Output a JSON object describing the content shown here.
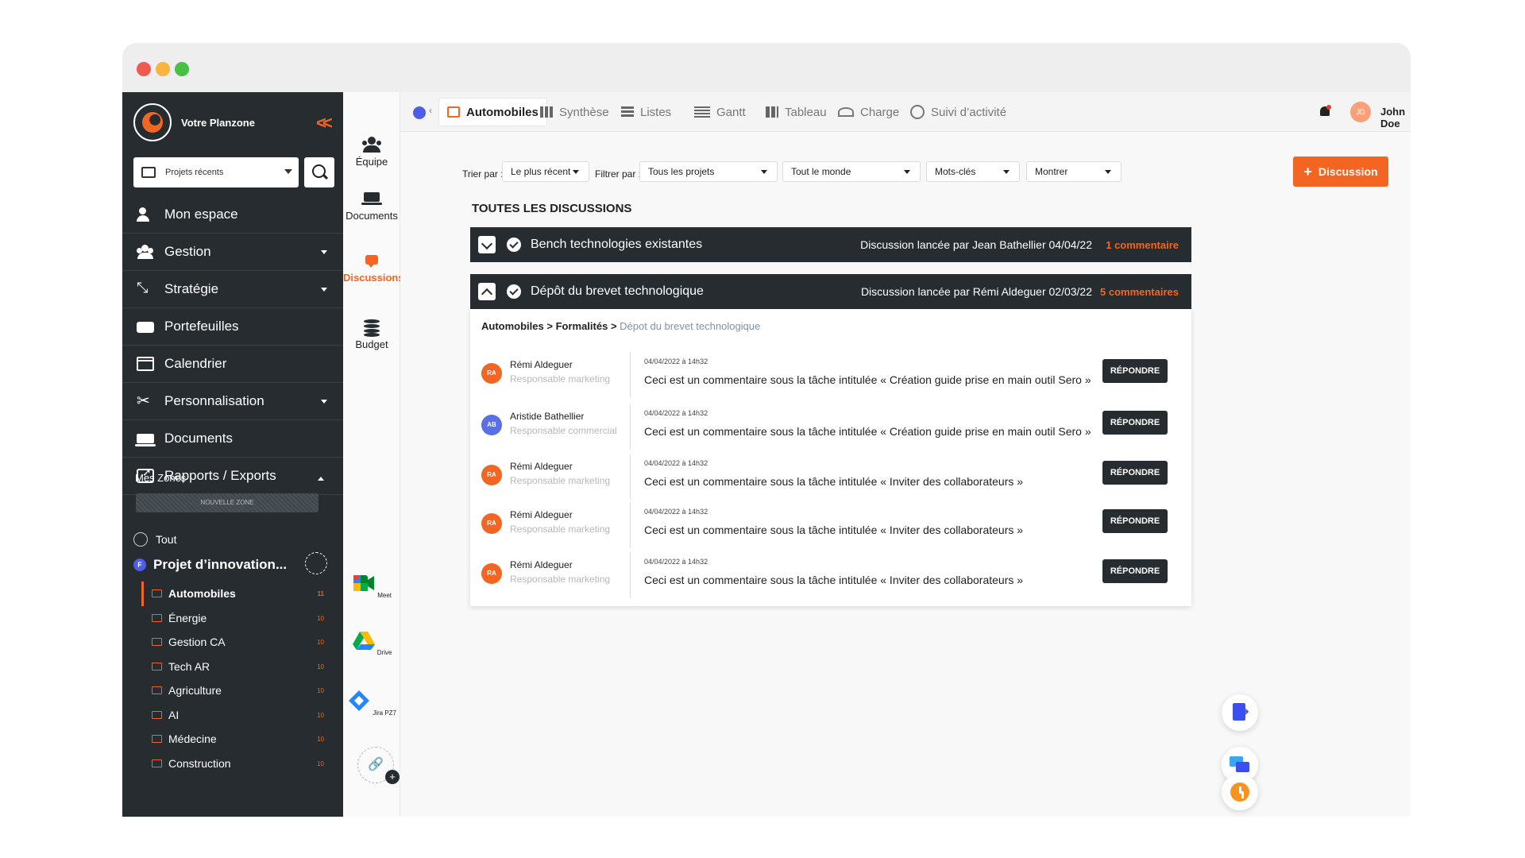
{
  "window": {
    "buttons": [
      "close",
      "minimize",
      "maximize"
    ],
    "colors": {
      "close": "#ee5a4f",
      "minimize": "#f6b53f",
      "maximize": "#47c046"
    }
  },
  "colors": {
    "accent": "#f26522",
    "sidebar": "#262c30",
    "breadcrumb_current": "#7f93a8"
  },
  "sidebar": {
    "brand": "Votre Planzone",
    "recent_projects": "Projets récents",
    "nav": [
      {
        "label": "Mon espace",
        "icon": "user-icon",
        "dropdown": false
      },
      {
        "label": "Gestion",
        "icon": "group-icon",
        "dropdown": true
      },
      {
        "label": "Stratégie",
        "icon": "strategy-icon",
        "dropdown": true
      },
      {
        "label": "Portefeuilles",
        "icon": "portfolio-icon",
        "dropdown": false
      },
      {
        "label": "Calendrier",
        "icon": "calendar-icon",
        "dropdown": false
      },
      {
        "label": "Personnalisation",
        "icon": "tools-icon",
        "dropdown": true
      },
      {
        "label": "Documents",
        "icon": "laptop-icon",
        "dropdown": false
      },
      {
        "label": "Rapports / Exports",
        "icon": "export-icon",
        "dropdown": false
      }
    ],
    "zones_title": "Mes Zones",
    "new_zone": "NOUVELLE ZONE",
    "all": "Tout",
    "project": {
      "badge": "F",
      "name": "Projet d’innovation..."
    },
    "subprojects": [
      {
        "label": "Automobiles",
        "count": "11",
        "active": true
      },
      {
        "label": "Énergie",
        "count": "10"
      },
      {
        "label": "Gestion CA",
        "count": "10"
      },
      {
        "label": "Tech AR",
        "count": "10"
      },
      {
        "label": "Agriculture",
        "count": "10"
      },
      {
        "label": "AI",
        "count": "10"
      },
      {
        "label": "Médecine",
        "count": "10"
      },
      {
        "label": "Construction",
        "count": "10"
      }
    ]
  },
  "tools": {
    "items": [
      {
        "label": "Équipe",
        "icon": "team-icon"
      },
      {
        "label": "Documents",
        "icon": "laptop-icon"
      },
      {
        "label": "Discussions",
        "icon": "chat-icon",
        "active": true
      },
      {
        "label": "Budget",
        "icon": "coins-icon"
      }
    ],
    "apps": [
      {
        "label": "Meet",
        "icon": "meet-icon"
      },
      {
        "label": "Drive",
        "icon": "drive-icon"
      },
      {
        "label": "Jira PZ7",
        "icon": "jira-icon"
      }
    ]
  },
  "tabs": [
    {
      "label": "Automobiles",
      "icon": "folder-icon",
      "active": true
    },
    {
      "label": "Synthèse",
      "icon": "grid-icon"
    },
    {
      "label": "Listes",
      "icon": "list-icon"
    },
    {
      "label": "Gantt",
      "icon": "gantt-icon"
    },
    {
      "label": "Tableau",
      "icon": "table-icon"
    },
    {
      "label": "Charge",
      "icon": "gauge-icon"
    },
    {
      "label": "Suivi d’activité",
      "icon": "clock-icon"
    }
  ],
  "user": {
    "initials": "JD",
    "name": "John Doe"
  },
  "filters": {
    "sort_label": "Trier par :",
    "sort_value": "Le plus récent",
    "filter_label": "Filtrer par :",
    "project_value": "Tous les projets",
    "people_value": "Tout le monde",
    "keywords_value": "Mots-clés",
    "show_value": "Montrer"
  },
  "new_discussion_button": "Discussion",
  "heading": "TOUTES LES DISCUSSIONS",
  "discussions": [
    {
      "title": "Bench technologies existantes",
      "meta": "Discussion lancée par Jean Bathellier 04/04/22",
      "comments": "1 commentaire",
      "expanded": false
    },
    {
      "title": "Dépôt du brevet technologique",
      "meta": "Discussion lancée par Rémi Aldeguer 02/03/22",
      "comments": "5 commentaires",
      "expanded": true
    }
  ],
  "breadcrumb": {
    "root": "Automobiles",
    "sep1": ">",
    "mid": "Formalités",
    "sep2": ">",
    "current": "Dépot du brevet technologique"
  },
  "comments": [
    {
      "initials": "RA",
      "color": "#f26522",
      "name": "Rémi Aldeguer",
      "role": "Responsable marketing",
      "date": "04/04/2022 à 14h32",
      "text": "Ceci est un commentaire sous la tâche intitulée « Création guide prise en main outil Sero »",
      "reply": "RÉPONDRE"
    },
    {
      "initials": "AB",
      "color": "#5a6ee6",
      "name": "Aristide Bathellier",
      "role": "Responsable commercial",
      "date": "04/04/2022 à 14h32",
      "text": "Ceci est un commentaire sous la tâche intitulée « Création guide prise en main outil Sero »",
      "reply": "RÉPONDRE"
    },
    {
      "initials": "RA",
      "color": "#f26522",
      "name": "Rémi Aldeguer",
      "role": "Responsable marketing",
      "date": "04/04/2022 à 14h32",
      "text": "Ceci est un commentaire sous la tâche intitulée « Inviter des collaborateurs »",
      "reply": "RÉPONDRE"
    },
    {
      "initials": "RA",
      "color": "#f26522",
      "name": "Rémi Aldeguer",
      "role": "Responsable marketing",
      "date": "04/04/2022 à 14h32",
      "text": "Ceci est un commentaire sous la tâche intitulée « Inviter des collaborateurs »",
      "reply": "RÉPONDRE"
    },
    {
      "initials": "RA",
      "color": "#f26522",
      "name": "Rémi Aldeguer",
      "role": "Responsable marketing",
      "date": "04/04/2022 à 14h32",
      "text": "Ceci est un commentaire sous la tâche intitulée « Inviter des collaborateurs »",
      "reply": "RÉPONDRE"
    }
  ],
  "floating_buttons": [
    "export-doc-icon",
    "chat-icon",
    "timer-icon"
  ]
}
